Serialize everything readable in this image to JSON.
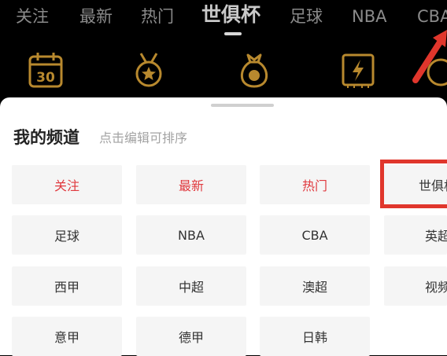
{
  "tabs": [
    {
      "label": "关注"
    },
    {
      "label": "最新"
    },
    {
      "label": "热门"
    },
    {
      "label": "世俱杯",
      "active": true
    },
    {
      "label": "足球"
    },
    {
      "label": "NBA"
    },
    {
      "label": "CBA"
    }
  ],
  "quick_icons": [
    {
      "icon": "calendar-30-icon",
      "text": "30"
    },
    {
      "icon": "medal-star-icon"
    },
    {
      "icon": "money-bag-icon"
    },
    {
      "icon": "lightning-ticket-icon"
    },
    {
      "icon": "partial-icon"
    }
  ],
  "sheet": {
    "title": "我的频道",
    "hint": "点击编辑可排序"
  },
  "channels": [
    {
      "label": "关注",
      "highlight": true
    },
    {
      "label": "最新",
      "highlight": true
    },
    {
      "label": "热门",
      "highlight": true
    },
    {
      "label": "世俱杯"
    },
    {
      "label": "足球"
    },
    {
      "label": "NBA"
    },
    {
      "label": "CBA"
    },
    {
      "label": "英超"
    },
    {
      "label": "西甲"
    },
    {
      "label": "中超"
    },
    {
      "label": "澳超"
    },
    {
      "label": "视频"
    },
    {
      "label": "意甲"
    },
    {
      "label": "德甲"
    },
    {
      "label": "日韩"
    }
  ],
  "colors": {
    "accent_red": "#e0393e",
    "icon_gold": "#b8892e",
    "annotation_red": "#e0362c"
  }
}
